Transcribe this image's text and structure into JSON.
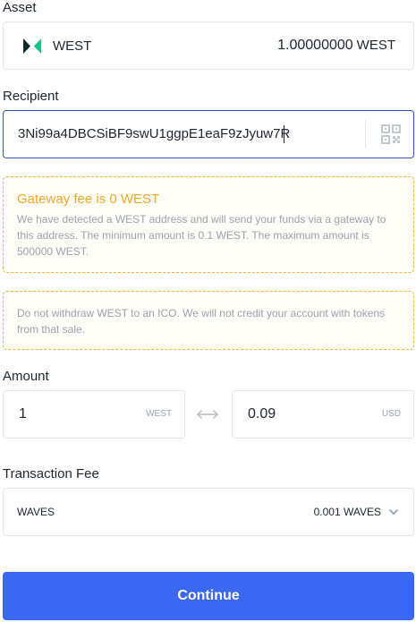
{
  "asset": {
    "label": "Asset",
    "name": "WEST",
    "balance": "1.00000000",
    "balance_unit": "WEST",
    "icon": "west-logo-icon"
  },
  "recipient": {
    "label": "Recipient",
    "value": "3Ni99a4DBCSiBF9swU1ggpE1eaF9zJyuw7R",
    "icon": "qr-code-icon"
  },
  "gateway_notice": {
    "title": "Gateway fee is 0 WEST",
    "text": "We have detected a WEST address and will send your funds via a gateway to this address. The minimum amount is 0.1 WEST. The maximum amount is 500000 WEST."
  },
  "ico_notice": {
    "text": "Do not withdraw WEST to an ICO. We will not credit your account with tokens from that sale."
  },
  "amount": {
    "label": "Amount",
    "value": "1",
    "unit": "WEST",
    "converted_value": "0.09",
    "converted_unit": "USD"
  },
  "fee": {
    "label": "Transaction Fee",
    "asset": "WAVES",
    "amount": "0.001 WAVES"
  },
  "continue_label": "Continue",
  "colors": {
    "accent": "#3a68f2",
    "warning": "#f0a82b",
    "focus_border": "#2f55c6"
  }
}
